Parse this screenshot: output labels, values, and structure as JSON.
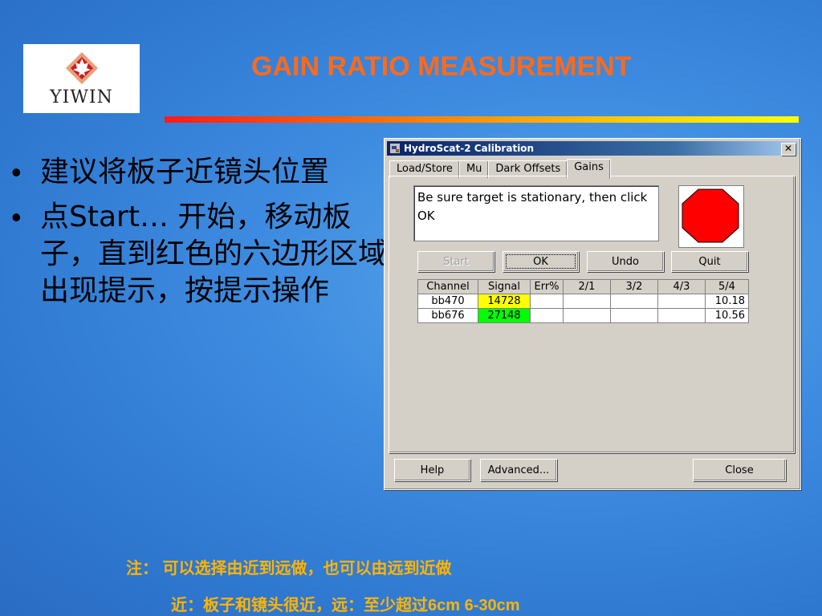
{
  "logo": {
    "text": "YIWIN"
  },
  "slide": {
    "title": "GAIN RATIO MEASUREMENT"
  },
  "bullets": [
    {
      "dot": "•",
      "text": "建议将板子近镜头位置"
    },
    {
      "dot": "•",
      "text": "点Start… 开始，移动板子，直到红色的六边形区域出现提示，按提示操作"
    }
  ],
  "dialog": {
    "title": "HydroScat-2 Calibration",
    "close_glyph": "✕",
    "tabs": [
      "Load/Store",
      "Mu",
      "Dark Offsets",
      "Gains"
    ],
    "active_tab": "Gains",
    "message": "Be sure target is stationary, then click OK",
    "status_color": "#ff0000",
    "buttons": {
      "start": "Start",
      "ok": "OK",
      "undo": "Undo",
      "quit": "Quit"
    },
    "table": {
      "headers": [
        "Channel",
        "Signal",
        "Err%",
        "2/1",
        "3/2",
        "4/3",
        "5/4"
      ],
      "rows": [
        {
          "channel": "bb470",
          "signal": "14728",
          "signal_color": "#ffff00",
          "err": "",
          "r21": "",
          "r32": "",
          "r43": "",
          "r54": "10.18"
        },
        {
          "channel": "bb676",
          "signal": "27148",
          "signal_color": "#00ff00",
          "err": "",
          "r21": "",
          "r32": "",
          "r43": "",
          "r54": "10.56"
        }
      ]
    },
    "footer": {
      "help": "Help",
      "advanced": "Advanced...",
      "close": "Close"
    }
  },
  "notes": {
    "line1": "注：  可以选择由近到远做，也可以由远到近做",
    "line2": "近：板子和镜头很近，远：至少超过6cm  6-30cm"
  }
}
